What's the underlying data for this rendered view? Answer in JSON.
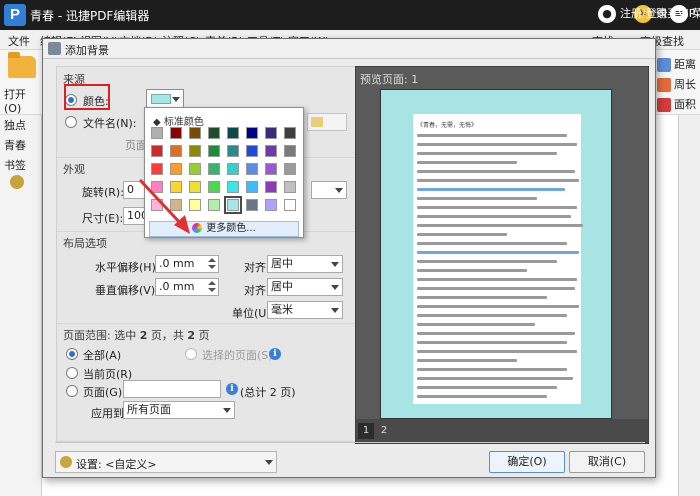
{
  "app": {
    "title": "青春 - 迅捷PDF编辑器",
    "logo_letter": "P"
  },
  "titlebar": {
    "login": "注册/登录",
    "vip": "购买VIP",
    "menu": "菜单"
  },
  "menubar": {
    "items": [
      "文件",
      "编辑(E)",
      "视图(V)",
      "文档(D)",
      "注释(C)",
      "表单(R)",
      "工具(T)",
      "窗口(W)"
    ],
    "right": [
      "查找",
      "高级查找"
    ]
  },
  "toolbar": {
    "open": "打开(O)",
    "right_tools": [
      "距离",
      "周长",
      "面积"
    ]
  },
  "left_panel": {
    "tab1": "独点",
    "tab2": "青春",
    "bookmarks": "书签"
  },
  "dialog": {
    "title": "添加背景",
    "source": {
      "section": "来源",
      "color_label": "颜色:",
      "file_label": "文件名(N):",
      "page_label": "页面:"
    },
    "appearance": {
      "section": "外观",
      "rotate_label": "旋转(R):",
      "rotate_value": "0",
      "size_label": "尺寸(E):",
      "size_value": "100%"
    },
    "layout": {
      "section": "布局选项",
      "h_offset_label": "水平偏移(H):",
      "h_offset_value": ".0 mm",
      "v_offset_label": "垂直偏移(V):",
      "v_offset_value": ".0 mm",
      "align1_label": "对齐:",
      "align1_value": "居中",
      "align2_label": "对齐:",
      "align2_value": "居中",
      "unit_label": "单位(U):",
      "unit_value": "毫米"
    },
    "page_range": {
      "section_prefix": "页面范围: 选中 ",
      "selected": "2",
      "section_mid": " 页，共 ",
      "total": "2",
      "section_suffix": " 页",
      "all": "全部(A)",
      "selected_pages": "选择的页面(S)",
      "current": "当前页(R)",
      "pages": "页面(G)",
      "total_pages": "(总计 2 页)",
      "apply_label": "应用到:",
      "apply_value": "所有页面"
    },
    "settings_label": "设置: <自定义>",
    "ok": "确定(O)",
    "cancel": "取消(C)",
    "preview_label": "预览页面: 1",
    "preview_tabs": [
      "1",
      "2"
    ],
    "preview_heading": "《青春，无需，无悔》"
  },
  "color_popup": {
    "header": "标准颜色",
    "more": "更多颜色...",
    "swatches": [
      [
        "#b0b0b0",
        "#8b0000",
        "#7a4a00",
        "#1e4d2b",
        "#0b4a4a",
        "#00008b",
        "#3b2b7a",
        "#3f3f3f"
      ],
      [
        "#cf2a2a",
        "#e07020",
        "#8b8b00",
        "#1e8b3b",
        "#2b8b8b",
        "#1f4bd6",
        "#6b3ba6",
        "#7a7a7a"
      ],
      [
        "#ff3b3b",
        "#ff9a2b",
        "#9acd32",
        "#3bb36b",
        "#36cfcf",
        "#5b8be6",
        "#9b59d0",
        "#9b9b9b"
      ],
      [
        "#ff7fbf",
        "#ffd42b",
        "#f0e030",
        "#4bd84b",
        "#3be6e6",
        "#3bbcff",
        "#8b3bb3",
        "#c0c0c0"
      ],
      [
        "#ffb3d9",
        "#d2b48c",
        "#ffff99",
        "#b3f0a6",
        "#a7e6e6",
        "#66778a",
        "#b0a0ff",
        "#ffffff"
      ]
    ],
    "selected_color": "#a7e6e6"
  }
}
